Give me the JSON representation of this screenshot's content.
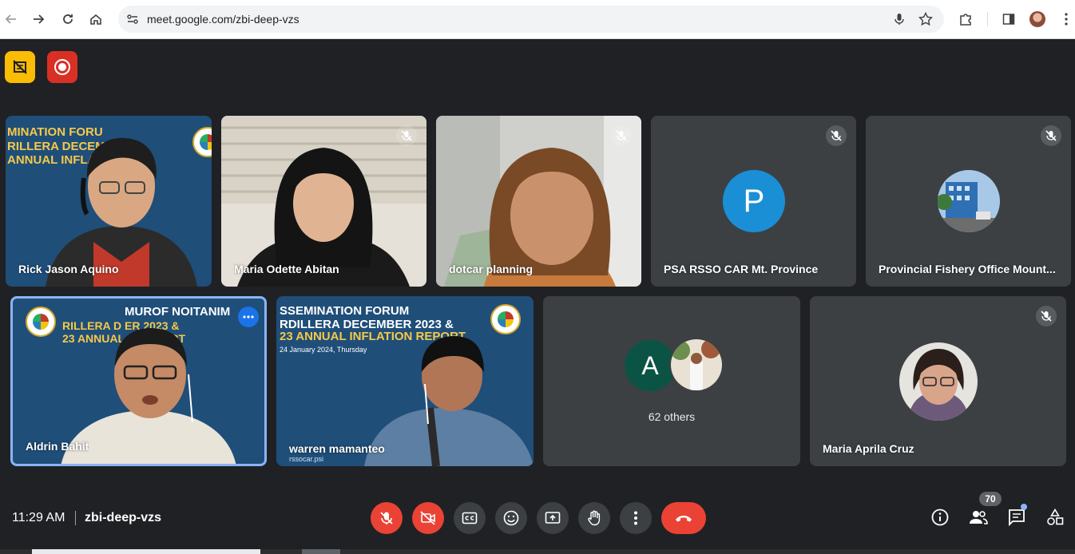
{
  "browser": {
    "url": "meet.google.com/zbi-deep-vzs"
  },
  "meeting": {
    "time": "11:29 AM",
    "code": "zbi-deep-vzs",
    "participant_count": "70"
  },
  "tiles": [
    {
      "name": "Rick Jason Aquino",
      "banner1": "MINATION FORU",
      "banner2": "RILLERA DECEM",
      "banner3": "ANNUAL INFLA",
      "muted": false
    },
    {
      "name": "Maria Odette Abitan",
      "muted": true
    },
    {
      "name": "dotcar planning",
      "muted": true
    },
    {
      "name": "PSA RSSO CAR Mt. Province",
      "initial": "P",
      "muted": true
    },
    {
      "name": "Provincial Fishery Office Mount...",
      "muted": true
    },
    {
      "name": "Aldrin Bahit",
      "banner1": "MUROF NOITANIM",
      "banner2": "RILLERA D  ER 2023 &",
      "banner3": "23 ANNUAL  N REPORT",
      "muted": false,
      "active": true
    },
    {
      "name": "warren mamanteo",
      "banner1": "SSEMINATION FORUM",
      "banner2": "RDILLERA DECEMBER 2023 &",
      "banner3": "23 ANNUAL INFLATION REPORT",
      "banner_date": "24 January 2024, Thursday",
      "site": "rssocar.psi",
      "muted": false
    },
    {
      "others_label": "62 others",
      "initial": "A"
    },
    {
      "name": "Maria Aprila Cruz",
      "muted": true
    }
  ],
  "colors": {
    "meet_bg": "#202124",
    "tile_bg": "#3c4043",
    "red": "#ea4335",
    "active_border": "#8ab4f8",
    "banner_blue": "#1f4e79",
    "avatar_p": "#1a8fd6",
    "avatar_a": "#0b5345"
  }
}
